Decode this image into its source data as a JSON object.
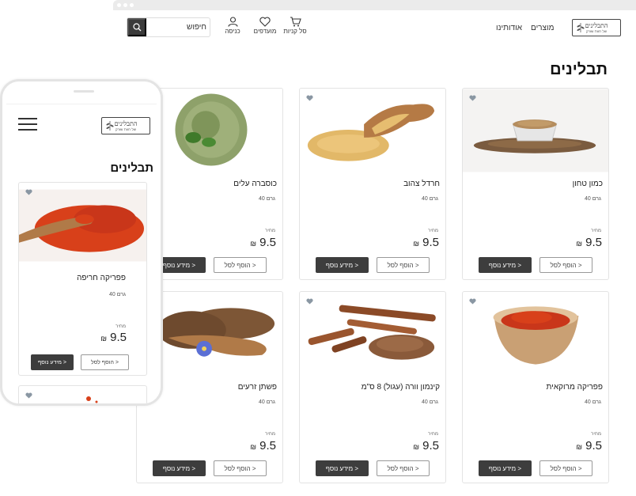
{
  "browser": {
    "dots": 3
  },
  "header": {
    "logo": {
      "main": "התבלינים",
      "sub": "של חוות שורק"
    },
    "nav": [
      {
        "label": "מוצרים"
      },
      {
        "label": "אודותינו"
      }
    ],
    "icons": [
      {
        "icon": "cart-icon",
        "label": "סל קניות"
      },
      {
        "icon": "heart-icon",
        "label": "מועדפים"
      },
      {
        "icon": "user-icon",
        "label": "כניסה"
      }
    ],
    "search": {
      "value": "חיפוש",
      "icon": "search-icon"
    }
  },
  "page_title": "תבלינים",
  "labels": {
    "price": "מחיר",
    "info_button": "מידע נוסף >",
    "add_button": "הוסף לסל >",
    "currency": "₪"
  },
  "products": [
    {
      "name": "כמון טחון",
      "weight": "40 גרם",
      "price": "9.5",
      "image": "ground-cumin-image"
    },
    {
      "name": "חרדל צהוב",
      "weight": "40 גרם",
      "price": "9.5",
      "image": "yellow-mustard-image"
    },
    {
      "name": "כוסברה עלים",
      "weight": "40 גרם",
      "price": "9.5",
      "image": "coriander-leaves-image"
    },
    {
      "name": "פפריקה מרוקאית",
      "weight": "40 גרם",
      "price": "9.5",
      "image": "moroccan-paprika-image"
    },
    {
      "name": "קינמון וורה (עגול) 8 ס\"מ",
      "weight": "40 גרם",
      "price": "9.5",
      "image": "cinnamon-sticks-image"
    },
    {
      "name": "פשתן זרעים",
      "weight": "40 גרם",
      "price": "9.5",
      "image": "flax-seeds-image"
    }
  ],
  "mobile": {
    "title": "תבלינים",
    "product": {
      "name": "פפריקה חריפה",
      "weight": "40 גרם",
      "price": "9.5",
      "image": "hot-paprika-image"
    }
  },
  "colors": {
    "button_dark": "#3d3d3d",
    "border": "#e3e3e3",
    "paprika": "#d8401a"
  }
}
